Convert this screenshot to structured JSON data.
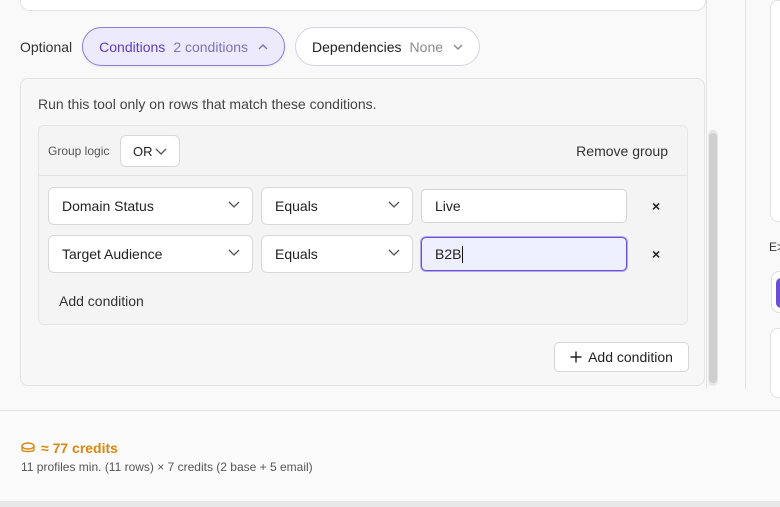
{
  "optional_label": "Optional",
  "chips": {
    "conditions": {
      "label": "Conditions",
      "value": "2 conditions",
      "icon": "chevron-up-icon"
    },
    "dependencies": {
      "label": "Dependencies",
      "value": "None",
      "icon": "chevron-down-icon"
    }
  },
  "panel": {
    "description": "Run this tool only on rows that match these conditions.",
    "group": {
      "logic_label": "Group logic",
      "logic_value": "OR",
      "remove_label": "Remove group",
      "conditions": [
        {
          "field": "Domain Status",
          "operator": "Equals",
          "value": "Live"
        },
        {
          "field": "Target Audience",
          "operator": "Equals",
          "value": "B2B"
        }
      ],
      "add_condition_label": "Add condition"
    },
    "add_condition_button": "Add condition"
  },
  "right_peek": {
    "label": "E>"
  },
  "footer": {
    "credits": "≈ 77 credits",
    "detail": "11 profiles min. (11 rows) × 7 credits (2 base + 5 email)"
  },
  "colors": {
    "accent": "#6b52d1",
    "credits": "#d9870f"
  }
}
